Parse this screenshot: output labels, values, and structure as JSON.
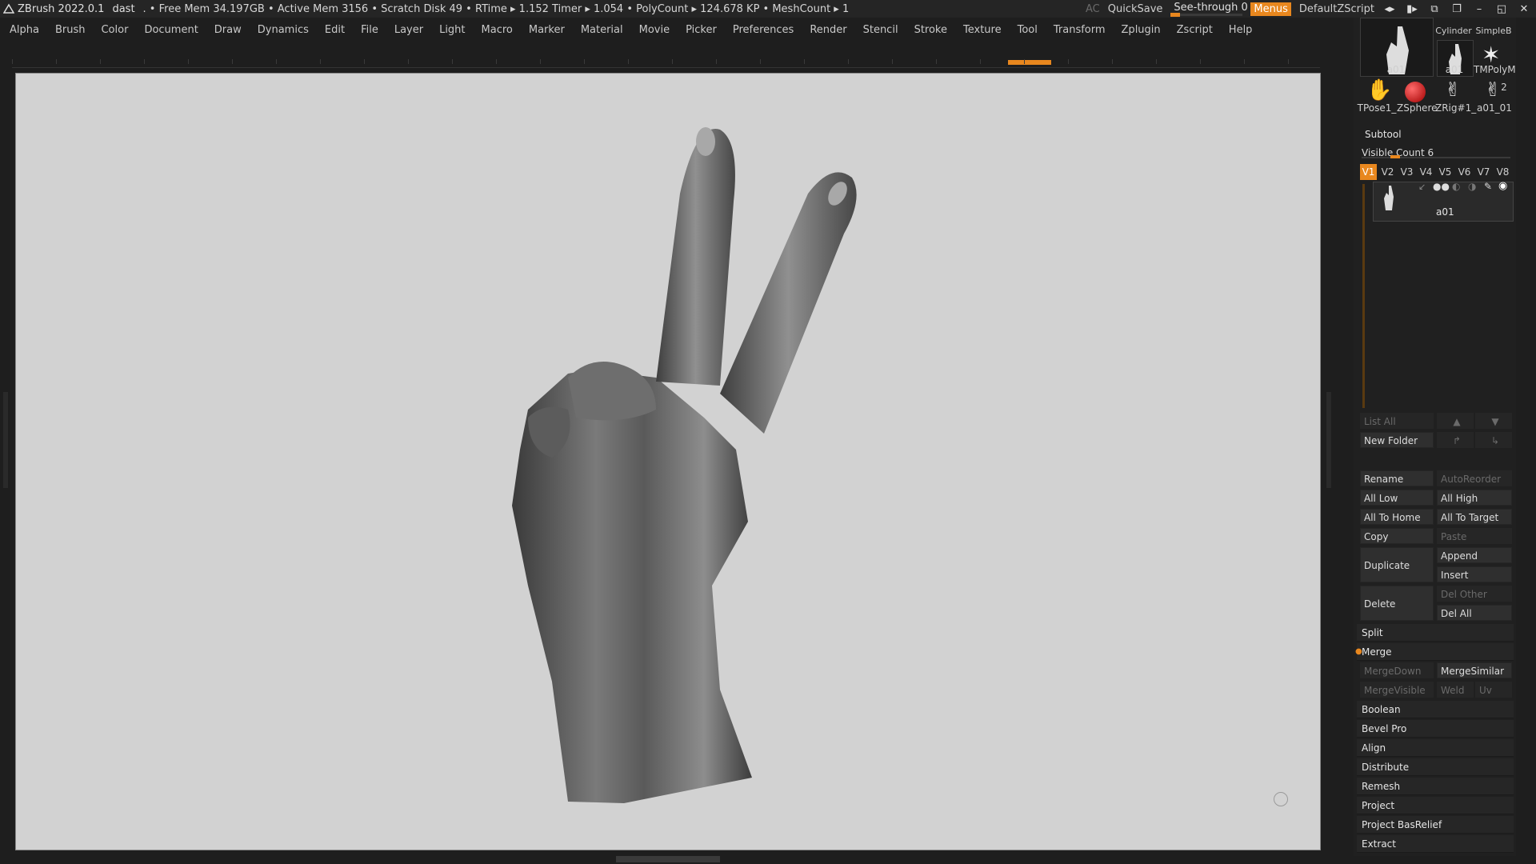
{
  "titlebar": {
    "app": "ZBrush 2022.0.1",
    "user": "dast",
    "status": ". • Free Mem 34.197GB • Active Mem 3156 • Scratch Disk 49 • RTime ▸ 1.152 Timer ▸ 1.054 • PolyCount ▸ 124.678 KP • MeshCount ▸ 1",
    "ac": "AC",
    "quicksave": "QuickSave",
    "see_through": "See-through  0",
    "menus": "Menus",
    "default_zscript": "DefaultZScript",
    "see_through_value": 0
  },
  "menubar": [
    "Alpha",
    "Brush",
    "Color",
    "Document",
    "Draw",
    "Dynamics",
    "Edit",
    "File",
    "Layer",
    "Light",
    "Macro",
    "Marker",
    "Material",
    "Movie",
    "Picker",
    "Preferences",
    "Render",
    "Stencil",
    "Stroke",
    "Texture",
    "Tool",
    "Transform",
    "Zplugin",
    "Zscript",
    "Help"
  ],
  "tools": {
    "main": "a01",
    "row1": [
      "Cylinder",
      "SimpleB",
      "a01",
      "TMPolyM"
    ],
    "row2": [
      "TPose1_",
      "ZSphere",
      "ZRig#1_",
      "a01_01"
    ],
    "badge": "2"
  },
  "subtool": {
    "title": "Subtool",
    "visible_count": "Visible Count 6",
    "tabs": [
      "V1",
      "V2",
      "V3",
      "V4",
      "V5",
      "V6",
      "V7",
      "V8"
    ],
    "item_label": "a01",
    "buttons": {
      "list_all": "List All",
      "new_folder": "New Folder",
      "rename": "Rename",
      "auto_reorder": "AutoReorder",
      "all_low": "All Low",
      "all_high": "All High",
      "all_to_home": "All To Home",
      "all_to_target": "All To Target",
      "copy": "Copy",
      "paste": "Paste",
      "duplicate": "Duplicate",
      "append": "Append",
      "insert": "Insert",
      "delete": "Delete",
      "del_other": "Del Other",
      "del_all": "Del All",
      "split": "Split",
      "merge": "Merge",
      "merge_down": "MergeDown",
      "merge_similar": "MergeSimilar",
      "merge_visible": "MergeVisible",
      "weld": "Weld",
      "uv": "Uv",
      "boolean": "Boolean",
      "bevel_pro": "Bevel Pro",
      "align": "Align",
      "distribute": "Distribute",
      "remesh": "Remesh",
      "project": "Project",
      "project_basrelief": "Project BasRelief",
      "extract": "Extract"
    }
  },
  "colors": {
    "accent": "#e8871e",
    "canvas": "#d2d2d2",
    "panel": "#202020"
  }
}
